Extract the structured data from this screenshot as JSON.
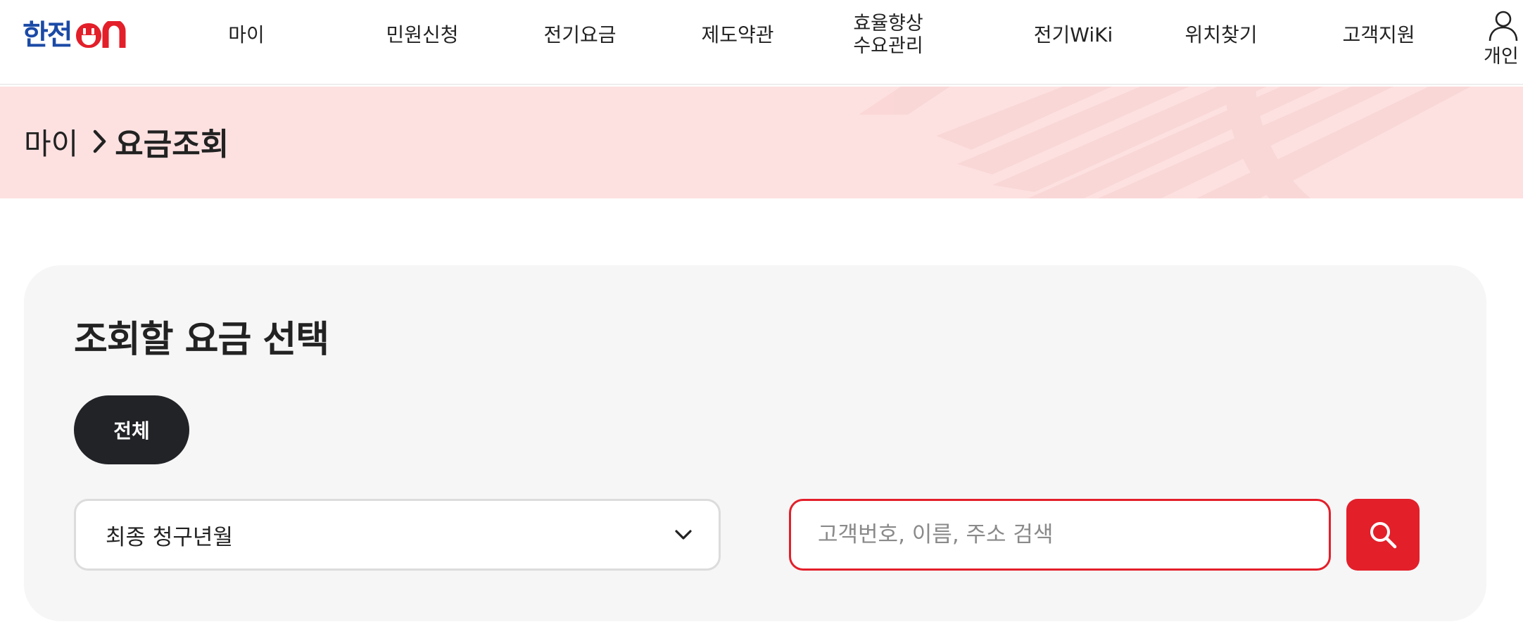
{
  "header": {
    "logo": {
      "text": "한전",
      "on_text": "ON"
    },
    "nav": [
      "마이",
      "민원신청",
      "전기요금",
      "제도약관",
      "효율향상\n수요관리",
      "전기WiKi",
      "위치찾기",
      "고객지원"
    ],
    "user_label": "개인"
  },
  "breadcrumb": {
    "home": "마이",
    "current": "요금조회"
  },
  "panel": {
    "title": "조회할 요금 선택",
    "chip_all": "전체",
    "select_value": "최종 청구년월",
    "search_placeholder": "고객번호, 이름, 주소 검색"
  },
  "colors": {
    "brand_red": "#e31f2a",
    "brand_blue": "#1b4aa6",
    "banner_pink": "#fde1e1",
    "panel_gray": "#f6f6f6",
    "chip_dark": "#222327"
  },
  "icons": [
    "user-icon",
    "chevron-right-icon",
    "chevron-down-icon",
    "search-icon",
    "plug-icon"
  ]
}
